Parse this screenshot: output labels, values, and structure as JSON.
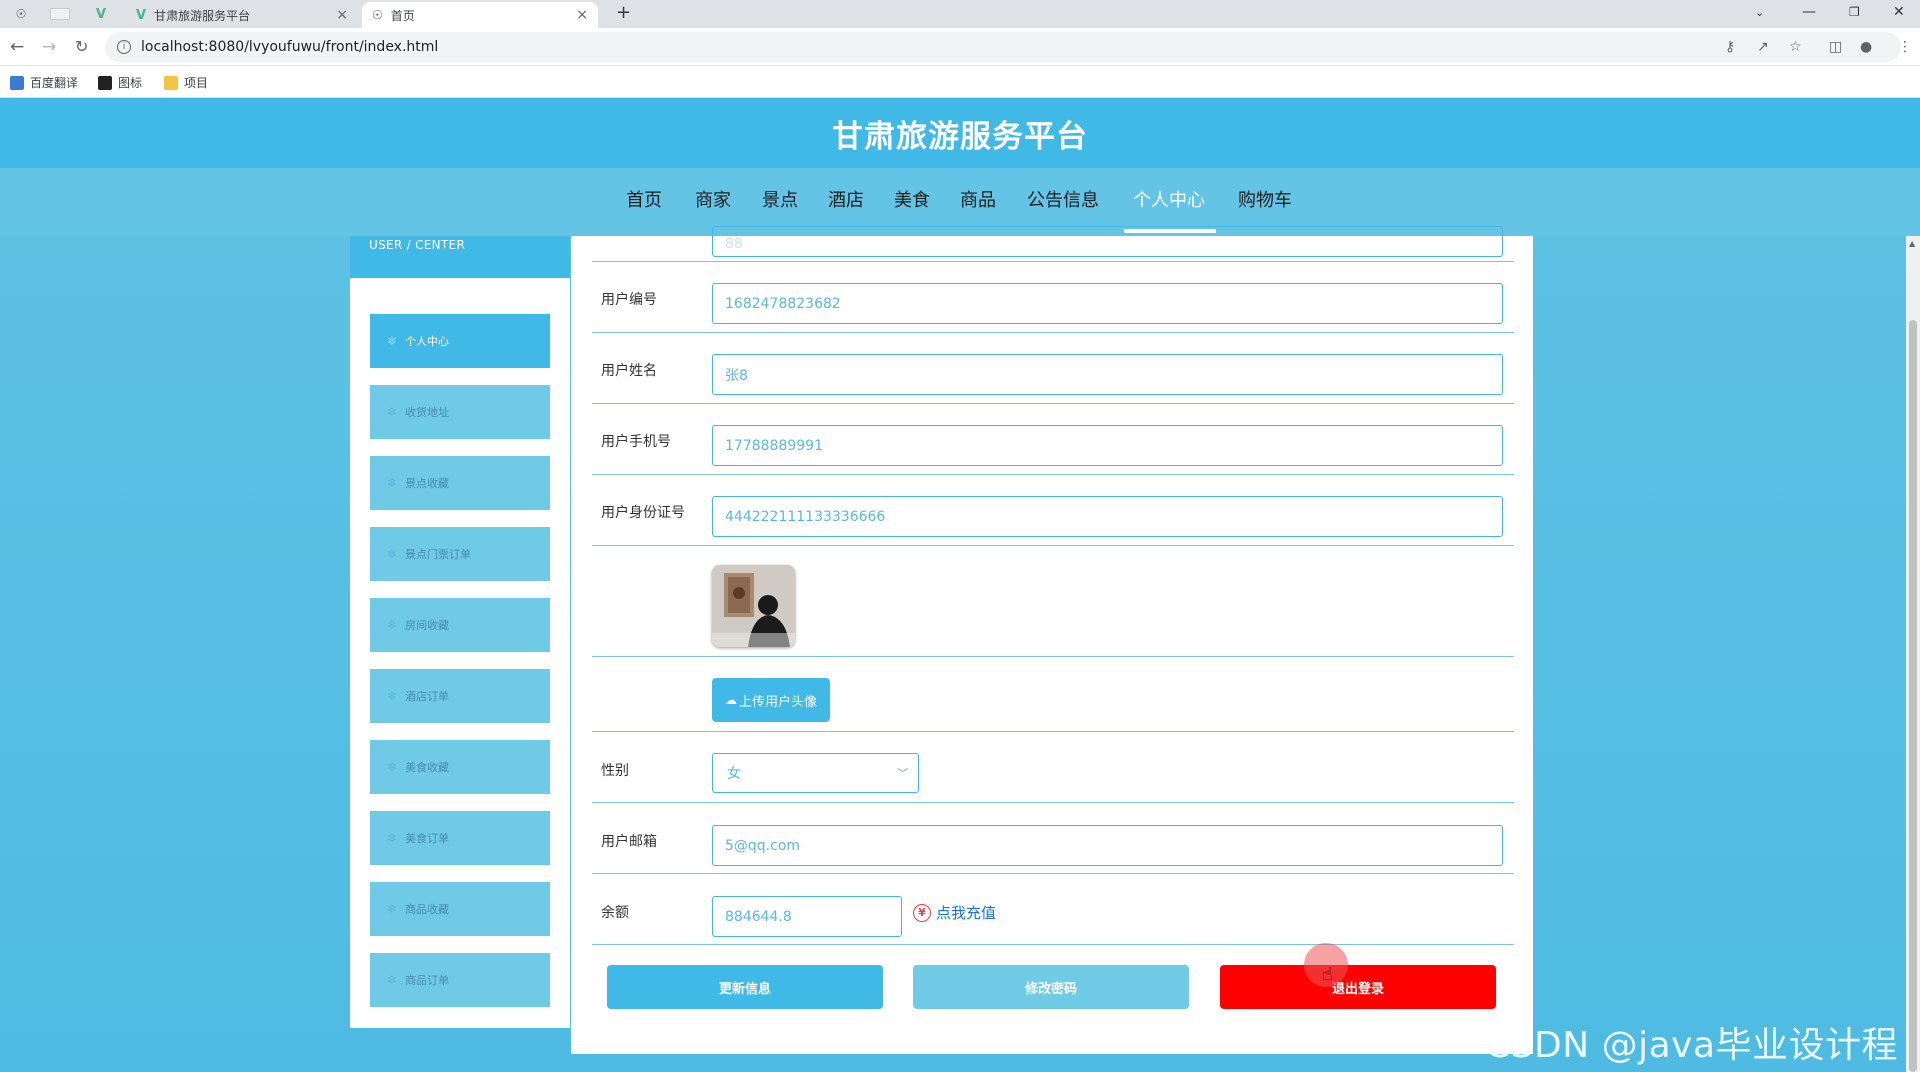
{
  "browser": {
    "tabs": [
      {
        "label": ""
      },
      {
        "label": ""
      },
      {
        "label": ""
      },
      {
        "label": "甘肃旅游服务平台"
      },
      {
        "label": "首页"
      }
    ],
    "new_tab": "+",
    "url": "localhost:8080/lvyoufuwu/front/index.html",
    "bookmarks": [
      {
        "label": "百度翻译",
        "color": "#3a7bd5"
      },
      {
        "label": "图标",
        "color": "#222222"
      },
      {
        "label": "项目",
        "color": "#f4c542"
      }
    ]
  },
  "site": {
    "title": "甘肃旅游服务平台",
    "nav": [
      {
        "label": "首页"
      },
      {
        "label": "商家"
      },
      {
        "label": "景点"
      },
      {
        "label": "酒店"
      },
      {
        "label": "美食"
      },
      {
        "label": "商品"
      },
      {
        "label": "公告信息"
      },
      {
        "label": "个人中心",
        "active": true
      },
      {
        "label": "购物车"
      }
    ]
  },
  "sidebar": {
    "header": "USER / CENTER",
    "items": [
      {
        "label": "个人中心",
        "active": true
      },
      {
        "label": "收货地址"
      },
      {
        "label": "景点收藏"
      },
      {
        "label": "景点门票订单"
      },
      {
        "label": "房间收藏"
      },
      {
        "label": "酒店订单"
      },
      {
        "label": "美食收藏"
      },
      {
        "label": "美食订单"
      },
      {
        "label": "商品收藏"
      },
      {
        "label": "商品订单"
      }
    ]
  },
  "form": {
    "top_partial_value": "88",
    "user_id": {
      "label": "用户编号",
      "value": "1682478823682"
    },
    "user_name": {
      "label": "用户姓名",
      "value": "张8"
    },
    "user_phone": {
      "label": "用户手机号",
      "value": "17788889991"
    },
    "user_idcard": {
      "label": "用户身份证号",
      "value": "444222111133336666"
    },
    "upload_label": "上传用户头像",
    "gender": {
      "label": "性别",
      "value": "女"
    },
    "email": {
      "label": "用户邮箱",
      "value": "5@qq.com"
    },
    "balance": {
      "label": "余额",
      "value": "884644.8"
    },
    "recharge_label": "点我充值",
    "recharge_icon": "¥",
    "buttons": {
      "update": "更新信息",
      "password": "修改密码",
      "logout": "退出登录"
    }
  },
  "colors": {
    "primary": "#41b9e6",
    "logout": "#ff0000"
  },
  "watermark": "CSDN @java毕业设计程序"
}
